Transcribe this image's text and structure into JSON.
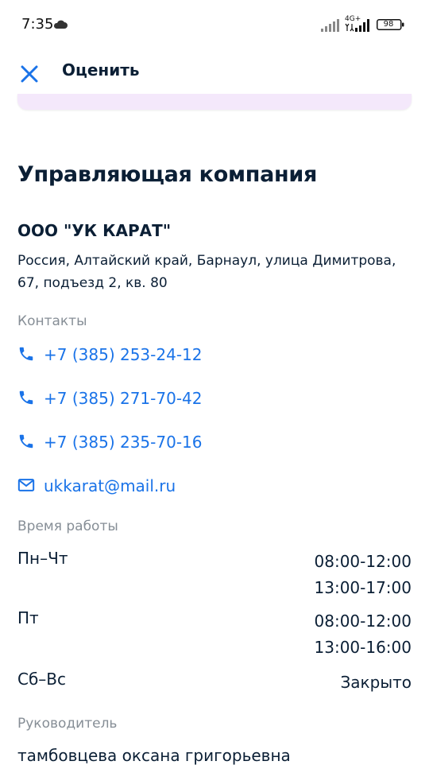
{
  "status_bar": {
    "time": "7:35",
    "network": "4G+",
    "battery": "98"
  },
  "header": {
    "title": "Оценить",
    "close_icon": "close-icon"
  },
  "company": {
    "section_title": "Управляющая компания",
    "name": "ООО \"УК КАРАТ\"",
    "address": "Россия, Алтайский край, Барнаул, улица Димитрова, 67, подъезд 2, кв. 80"
  },
  "contacts": {
    "label": "Контакты",
    "phones": [
      "+7 (385) 253-24-12",
      "+7 (385) 271-70-42",
      "+7 (385) 235-70-16"
    ],
    "email": "ukkarat@mail.ru"
  },
  "schedule": {
    "label": "Время работы",
    "rows": [
      {
        "day": "Пн–Чт",
        "hours": [
          "08:00-12:00",
          "13:00-17:00"
        ]
      },
      {
        "day": "Пт",
        "hours": [
          "08:00-12:00",
          "13:00-16:00"
        ]
      },
      {
        "day": "Сб–Вс",
        "hours": [
          "Закрыто"
        ]
      }
    ]
  },
  "manager": {
    "label": "Руководитель",
    "name": "тамбовцева оксана григорьевна"
  },
  "colors": {
    "accent": "#1a73e8",
    "text": "#0b1f35",
    "muted": "#868e96",
    "banner": "#f4e8fb"
  }
}
